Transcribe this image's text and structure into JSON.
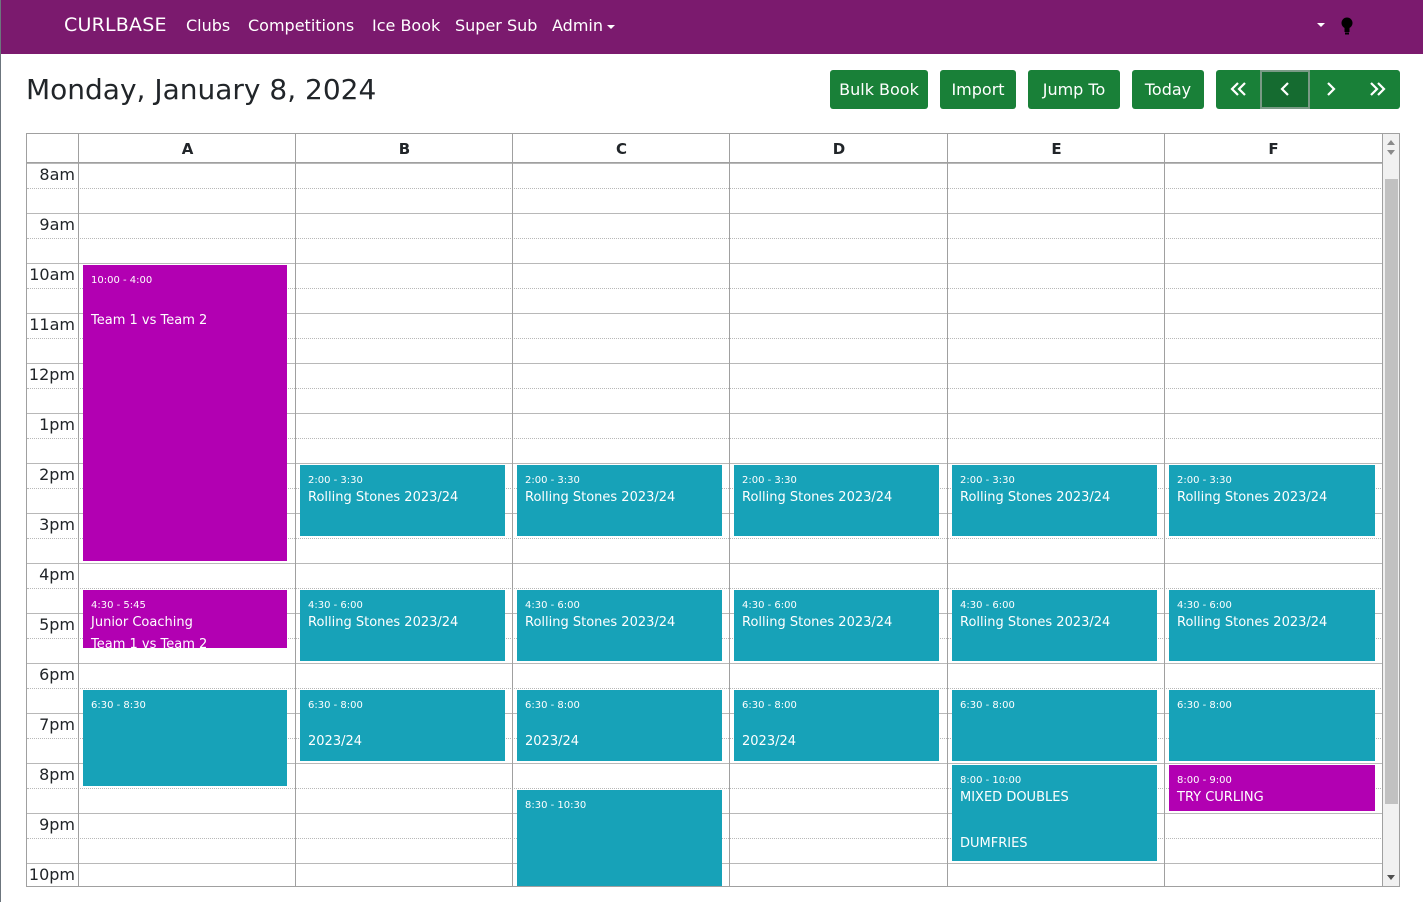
{
  "navbar": {
    "brand": "CURLBASE",
    "links": [
      "Clubs",
      "Competitions",
      "Ice Book",
      "Super Sub",
      "Admin"
    ]
  },
  "header": {
    "date": "Monday, January 8, 2024",
    "buttons": [
      "Bulk Book",
      "Import",
      "Jump To",
      "Today"
    ],
    "nav_icons": [
      "double-left-icon",
      "chevron-left-icon",
      "chevron-right-icon",
      "double-right-icon"
    ]
  },
  "calendar": {
    "sheets": [
      "A",
      "B",
      "C",
      "D",
      "E",
      "F"
    ],
    "times": [
      "8am",
      "9am",
      "10am",
      "11am",
      "12pm",
      "1pm",
      "2pm",
      "3pm",
      "4pm",
      "5pm",
      "6pm",
      "7pm",
      "8pm",
      "9pm",
      "10pm"
    ],
    "events": [
      {
        "time": "10:00 - 4:00",
        "title": "Team 1 vs Team 2",
        "sub": ""
      },
      {
        "time": "4:30 - 5:45",
        "title": "Junior Coaching",
        "sub": "Team 1 vs Team 2"
      },
      {
        "time": "6:30 - 8:30",
        "title": "",
        "sub": ""
      },
      {
        "time": "2:00 - 3:30",
        "title": "Rolling Stones 2023/24",
        "sub": ""
      },
      {
        "time": "4:30 - 6:00",
        "title": "Rolling Stones 2023/24",
        "sub": ""
      },
      {
        "time": "6:30 - 8:00",
        "title": "2023/24",
        "sub": ""
      },
      {
        "time": "2:00 - 3:30",
        "title": "Rolling Stones 2023/24",
        "sub": ""
      },
      {
        "time": "4:30 - 6:00",
        "title": "Rolling Stones 2023/24",
        "sub": ""
      },
      {
        "time": "6:30 - 8:00",
        "title": "2023/24",
        "sub": ""
      },
      {
        "time": "8:30 - 10:30",
        "title": "",
        "sub": ""
      },
      {
        "time": "2:00 - 3:30",
        "title": "Rolling Stones 2023/24",
        "sub": ""
      },
      {
        "time": "4:30 - 6:00",
        "title": "Rolling Stones 2023/24",
        "sub": ""
      },
      {
        "time": "6:30 - 8:00",
        "title": "2023/24",
        "sub": ""
      },
      {
        "time": "2:00 - 3:30",
        "title": "Rolling Stones 2023/24",
        "sub": ""
      },
      {
        "time": "4:30 - 6:00",
        "title": "Rolling Stones 2023/24",
        "sub": ""
      },
      {
        "time": "6:30 - 8:00",
        "title": "",
        "sub": ""
      },
      {
        "time": "8:00 - 10:00",
        "title": "MIXED DOUBLES",
        "sub": "DUMFRIES"
      },
      {
        "time": "2:00 - 3:30",
        "title": "Rolling Stones 2023/24",
        "sub": ""
      },
      {
        "time": "4:30 - 6:00",
        "title": "Rolling Stones 2023/24",
        "sub": ""
      },
      {
        "time": "6:30 - 8:00",
        "title": "",
        "sub": ""
      },
      {
        "time": "8:00 - 9:00",
        "title": "TRY CURLING",
        "sub": ""
      }
    ]
  },
  "colors": {
    "navbar": "#7b1a6e",
    "button": "#198038",
    "event_teal": "#17a2b8",
    "event_magenta": "#b200b2"
  }
}
